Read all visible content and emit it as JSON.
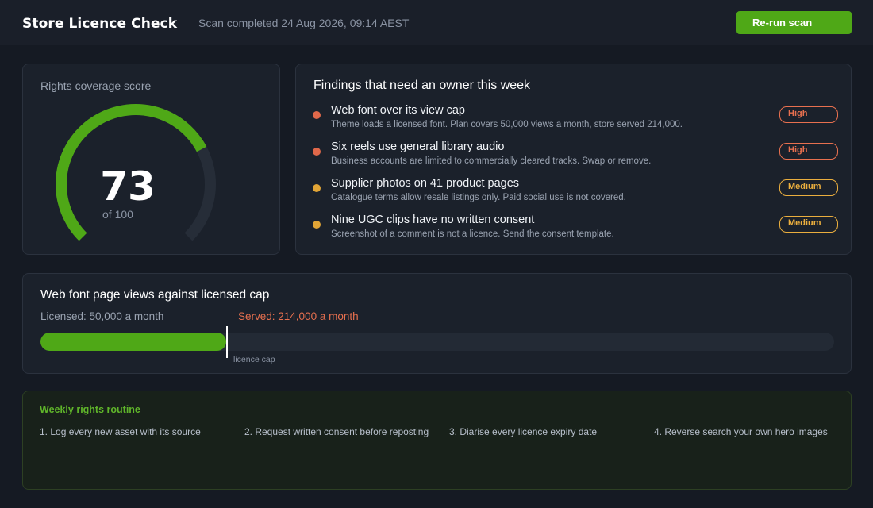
{
  "header": {
    "title": "Store Licence Check",
    "scan_status": "Scan completed 24 Aug 2026, 09:14 AEST",
    "rerun_label": "Re-run scan"
  },
  "score": {
    "label": "Rights coverage score",
    "value": 73,
    "max_label": "of 100",
    "max": 100,
    "accent": "#4fa817"
  },
  "findings": {
    "title": "Findings that need an owner this week",
    "items": [
      {
        "title": "Web font over its view cap",
        "description": "Theme loads a licensed font. Plan covers 50,000 views a month, store served 214,000.",
        "severity": "High",
        "color": "#e0684a"
      },
      {
        "title": "Six reels use general library audio",
        "description": "Business accounts are limited to commercially cleared tracks. Swap or remove.",
        "severity": "High",
        "color": "#e0684a"
      },
      {
        "title": "Supplier photos on 41 product pages",
        "description": "Catalogue terms allow resale listings only. Paid social use is not covered.",
        "severity": "Medium",
        "color": "#e2a536"
      },
      {
        "title": "Nine UGC clips have no written consent",
        "description": "Screenshot of a comment is not a licence. Send the consent template.",
        "severity": "Medium",
        "color": "#e2a536"
      }
    ]
  },
  "usage": {
    "title": "Web font page views against licensed cap",
    "licensed_label": "Licensed: 50,000 a month",
    "served_label": "Served: 214,000 a month",
    "cap_label": "licence cap",
    "licensed": 50000,
    "served": 214000
  },
  "routine": {
    "title": "Weekly rights routine",
    "steps": [
      "1. Log every new asset with its source",
      "2. Request written consent before reposting",
      "3. Diarise every licence expiry date",
      "4. Reverse search your own hero images"
    ]
  }
}
